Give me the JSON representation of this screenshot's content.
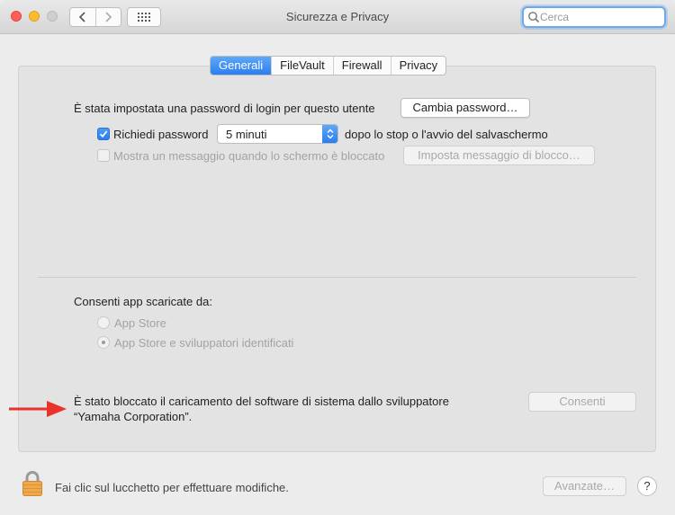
{
  "window": {
    "title": "Sicurezza e Privacy"
  },
  "search": {
    "placeholder": "Cerca",
    "value": ""
  },
  "tabs": [
    {
      "label": "Generali",
      "active": true
    },
    {
      "label": "FileVault",
      "active": false
    },
    {
      "label": "Firewall",
      "active": false
    },
    {
      "label": "Privacy",
      "active": false
    }
  ],
  "general": {
    "password_text": "È stata impostata una password di login per questo utente",
    "change_password_button": "Cambia password…",
    "require_password_label": "Richiedi password",
    "require_password_checked": true,
    "require_password_delay": "5 minuti",
    "require_password_suffix": "dopo lo stop o l'avvio del salvaschermo",
    "show_message_label": "Mostra un messaggio quando lo schermo è bloccato",
    "show_message_checked": false,
    "set_message_button": "Imposta messaggio di blocco…"
  },
  "downloads": {
    "heading": "Consenti app scaricate da:",
    "options": [
      {
        "label": "App Store",
        "selected": false
      },
      {
        "label": "App Store e sviluppatori identificati",
        "selected": true
      }
    ]
  },
  "blocked": {
    "line1": "È stato bloccato il caricamento del software di sistema dallo sviluppatore",
    "line2": "“Yamaha Corporation”.",
    "allow_button": "Consenti"
  },
  "footer": {
    "lock_text": "Fai clic sul lucchetto per effettuare modifiche.",
    "advanced_button": "Avanzate…",
    "help_label": "?"
  },
  "colors": {
    "accent": "#2a7ef0",
    "annotation_arrow": "#e8322a"
  }
}
